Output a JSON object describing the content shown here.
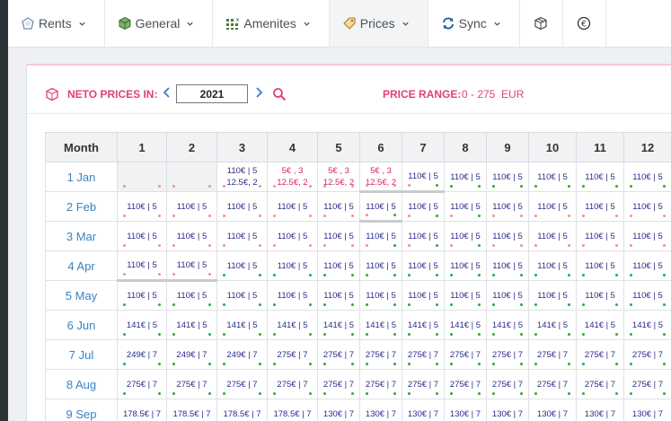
{
  "nav": [
    {
      "label": "Rents",
      "icon": "rents-icon",
      "dropdown": true
    },
    {
      "label": "General",
      "icon": "general-cube-icon",
      "dropdown": true
    },
    {
      "label": "Amenites",
      "icon": "amenities-grid-icon",
      "dropdown": true
    },
    {
      "label": "Prices",
      "icon": "price-tag-icon",
      "dropdown": true,
      "active": true
    },
    {
      "label": "Sync",
      "icon": "sync-icon",
      "dropdown": true
    },
    {
      "label": "",
      "icon": "box-icon",
      "dropdown": false
    },
    {
      "label": "",
      "icon": "euro-icon",
      "dropdown": false
    }
  ],
  "toolbar": {
    "neto_label": "NETO PRICES IN:",
    "year": "2021",
    "range_label": "PRICE RANGE:",
    "range_value": "0 - 275  EUR"
  },
  "grid": {
    "month_header": "Month",
    "days": [
      "1",
      "2",
      "3",
      "4",
      "5",
      "6",
      "7",
      "8",
      "9",
      "10",
      "11",
      "12"
    ],
    "rows": [
      {
        "month": "1 Jan",
        "cells": [
          {
            "t": "",
            "empty": true,
            "dot": "p",
            "dotl": "p"
          },
          {
            "t": "",
            "empty": true,
            "dot": "p",
            "dotl": "p"
          },
          {
            "t": "110€ | 5",
            "t2": "12.5€, 2",
            "dot": "p",
            "dotl": "p"
          },
          {
            "t": "5€ , 3",
            "t2": "12.5€, 2",
            "red": true,
            "dot": "p",
            "dotl": "p"
          },
          {
            "t": "5€ , 3",
            "t2": "12.5€, 2",
            "red": true,
            "dot": "p",
            "dotl": "p"
          },
          {
            "t": "5€ , 3",
            "t2": "12.5€, 2",
            "red": true,
            "dot": "p",
            "dotl": "p",
            "thick": true
          },
          {
            "t": "110€ | 5",
            "dot": "g",
            "dotl": "p",
            "thick": true
          },
          {
            "t": "110€ | 5",
            "dot": "g",
            "dotl": "g"
          },
          {
            "t": "110€ | 5",
            "dot": "g",
            "dotl": "g"
          },
          {
            "t": "110€ | 5",
            "dot": "g",
            "dotl": "g"
          },
          {
            "t": "110€ | 5",
            "dot": "g",
            "dotl": "g"
          },
          {
            "t": "110€ | 5",
            "dot": "g",
            "dotl": "g"
          }
        ]
      },
      {
        "month": "2 Feb",
        "cells": [
          {
            "t": "110€ | 5",
            "dot": "p",
            "dotl": "p"
          },
          {
            "t": "110€ | 5",
            "dot": "p",
            "dotl": "p"
          },
          {
            "t": "110€ | 5",
            "dot": "p",
            "dotl": "p"
          },
          {
            "t": "110€ | 5",
            "dot": "p",
            "dotl": "p"
          },
          {
            "t": "110€ | 5",
            "dot": "p",
            "dotl": "p"
          },
          {
            "t": "110€ | 5",
            "dot": "g",
            "dotl": "p",
            "thick": true
          },
          {
            "t": "110€ | 5",
            "dot": "g",
            "dotl": "p"
          },
          {
            "t": "110€ | 5",
            "dot": "g",
            "dotl": "p"
          },
          {
            "t": "110€ | 5",
            "dot": "p",
            "dotl": "p"
          },
          {
            "t": "110€ | 5",
            "dot": "p",
            "dotl": "p"
          },
          {
            "t": "110€ | 5",
            "dot": "p",
            "dotl": "p"
          },
          {
            "t": "110€ | 5",
            "dot": "p",
            "dotl": "p"
          }
        ]
      },
      {
        "month": "3 Mar",
        "cells": [
          {
            "t": "110€ | 5",
            "dot": "p",
            "dotl": "p"
          },
          {
            "t": "110€ | 5",
            "dot": "p",
            "dotl": "p"
          },
          {
            "t": "110€ | 5",
            "dot": "p",
            "dotl": "p"
          },
          {
            "t": "110€ | 5",
            "dot": "p",
            "dotl": "p"
          },
          {
            "t": "110€ | 5",
            "dot": "p",
            "dotl": "p"
          },
          {
            "t": "110€ | 5",
            "dot": "g",
            "dotl": "p"
          },
          {
            "t": "110€ | 5",
            "dot": "g",
            "dotl": "p"
          },
          {
            "t": "110€ | 5",
            "dot": "g",
            "dotl": "p"
          },
          {
            "t": "110€ | 5",
            "dot": "p",
            "dotl": "p"
          },
          {
            "t": "110€ | 5",
            "dot": "p",
            "dotl": "p"
          },
          {
            "t": "110€ | 5",
            "dot": "p",
            "dotl": "p"
          },
          {
            "t": "110€ | 5",
            "dot": "p",
            "dotl": "p"
          }
        ]
      },
      {
        "month": "4 Apr",
        "cells": [
          {
            "t": "110€ | 5",
            "dot": "p",
            "dotl": "p"
          },
          {
            "t": "110€ | 5",
            "dot": "p",
            "dotl": "p"
          },
          {
            "t": "110€ | 5",
            "dot": "g",
            "dotl": "g"
          },
          {
            "t": "110€ | 5",
            "dot": "g",
            "dotl": "g"
          },
          {
            "t": "110€ | 5",
            "dot": "g",
            "dotl": "g"
          },
          {
            "t": "110€ | 5",
            "dot": "g",
            "dotl": "g"
          },
          {
            "t": "110€ | 5",
            "dot": "g",
            "dotl": "g"
          },
          {
            "t": "110€ | 5",
            "dot": "g",
            "dotl": "g"
          },
          {
            "t": "110€ | 5",
            "dot": "g",
            "dotl": "g"
          },
          {
            "t": "110€ | 5",
            "dot": "g",
            "dotl": "g"
          },
          {
            "t": "110€ | 5",
            "dot": "g",
            "dotl": "g"
          },
          {
            "t": "110€ | 5",
            "dot": "g",
            "dotl": "g"
          }
        ]
      },
      {
        "month": "5 May",
        "cells": [
          {
            "t": "110€ | 5",
            "dot": "g",
            "dotl": "g",
            "thicktop": true
          },
          {
            "t": "110€ | 5",
            "dot": "g",
            "dotl": "g",
            "thicktop": true
          },
          {
            "t": "110€ | 5",
            "dot": "g",
            "dotl": "g"
          },
          {
            "t": "110€ | 5",
            "dot": "g",
            "dotl": "g"
          },
          {
            "t": "110€ | 5",
            "dot": "g",
            "dotl": "g"
          },
          {
            "t": "110€ | 5",
            "dot": "g",
            "dotl": "g"
          },
          {
            "t": "110€ | 5",
            "dot": "g",
            "dotl": "g"
          },
          {
            "t": "110€ | 5",
            "dot": "g",
            "dotl": "g"
          },
          {
            "t": "110€ | 5",
            "dot": "g",
            "dotl": "g"
          },
          {
            "t": "110€ | 5",
            "dot": "g",
            "dotl": "g"
          },
          {
            "t": "110€ | 5",
            "dot": "g",
            "dotl": "g"
          },
          {
            "t": "110€ | 5",
            "dot": "g",
            "dotl": "g"
          }
        ]
      },
      {
        "month": "6 Jun",
        "cells": [
          {
            "t": "141€ | 5",
            "dot": "g",
            "dotl": "g"
          },
          {
            "t": "141€ | 5",
            "dot": "g",
            "dotl": "g"
          },
          {
            "t": "141€ | 5",
            "dot": "g",
            "dotl": "g"
          },
          {
            "t": "141€ | 5",
            "dot": "g",
            "dotl": "g"
          },
          {
            "t": "141€ | 5",
            "dot": "g",
            "dotl": "g"
          },
          {
            "t": "141€ | 5",
            "dot": "g",
            "dotl": "g"
          },
          {
            "t": "141€ | 5",
            "dot": "g",
            "dotl": "g"
          },
          {
            "t": "141€ | 5",
            "dot": "g",
            "dotl": "g"
          },
          {
            "t": "141€ | 5",
            "dot": "g",
            "dotl": "g"
          },
          {
            "t": "141€ | 5",
            "dot": "g",
            "dotl": "g"
          },
          {
            "t": "141€ | 5",
            "dot": "g",
            "dotl": "g"
          },
          {
            "t": "141€ | 5",
            "dot": "g",
            "dotl": "g"
          }
        ]
      },
      {
        "month": "7 Jul",
        "cells": [
          {
            "t": "249€ | 7",
            "dot": "g",
            "dotl": "g"
          },
          {
            "t": "249€ | 7",
            "dot": "g",
            "dotl": "g"
          },
          {
            "t": "249€ | 7",
            "dot": "g",
            "dotl": "g"
          },
          {
            "t": "275€ | 7",
            "dot": "g",
            "dotl": "g"
          },
          {
            "t": "275€ | 7",
            "dot": "g",
            "dotl": "g"
          },
          {
            "t": "275€ | 7",
            "dot": "g",
            "dotl": "g"
          },
          {
            "t": "275€ | 7",
            "dot": "g",
            "dotl": "g"
          },
          {
            "t": "275€ | 7",
            "dot": "g",
            "dotl": "g"
          },
          {
            "t": "275€ | 7",
            "dot": "g",
            "dotl": "g"
          },
          {
            "t": "275€ | 7",
            "dot": "g",
            "dotl": "g"
          },
          {
            "t": "275€ | 7",
            "dot": "g",
            "dotl": "g"
          },
          {
            "t": "275€ | 7",
            "dot": "g",
            "dotl": "g"
          }
        ]
      },
      {
        "month": "8 Aug",
        "cells": [
          {
            "t": "275€ | 7",
            "dot": "g",
            "dotl": "g"
          },
          {
            "t": "275€ | 7",
            "dot": "g",
            "dotl": "g"
          },
          {
            "t": "275€ | 7",
            "dot": "g",
            "dotl": "g"
          },
          {
            "t": "275€ | 7",
            "dot": "g",
            "dotl": "g"
          },
          {
            "t": "275€ | 7",
            "dot": "g",
            "dotl": "g"
          },
          {
            "t": "275€ | 7",
            "dot": "g",
            "dotl": "g"
          },
          {
            "t": "275€ | 7",
            "dot": "g",
            "dotl": "g"
          },
          {
            "t": "275€ | 7",
            "dot": "g",
            "dotl": "g"
          },
          {
            "t": "275€ | 7",
            "dot": "g",
            "dotl": "g"
          },
          {
            "t": "275€ | 7",
            "dot": "g",
            "dotl": "g"
          },
          {
            "t": "275€ | 7",
            "dot": "g",
            "dotl": "g"
          },
          {
            "t": "275€ | 7",
            "dot": "g",
            "dotl": "g"
          }
        ]
      },
      {
        "month": "9 Sep",
        "cells": [
          {
            "t": "178.5€ | 7",
            "dot": "g",
            "dotl": "g"
          },
          {
            "t": "178.5€ | 7",
            "dot": "g",
            "dotl": "g"
          },
          {
            "t": "178.5€ | 7",
            "dot": "g",
            "dotl": "g"
          },
          {
            "t": "178.5€ | 7",
            "dot": "g",
            "dotl": "g"
          },
          {
            "t": "130€ | 7",
            "dot": "g",
            "dotl": "g"
          },
          {
            "t": "130€ | 7",
            "dot": "g",
            "dotl": "g"
          },
          {
            "t": "130€ | 7",
            "dot": "g",
            "dotl": "g"
          },
          {
            "t": "130€ | 7",
            "dot": "g",
            "dotl": "g"
          },
          {
            "t": "130€ | 7",
            "dot": "g",
            "dotl": "g"
          },
          {
            "t": "130€ | 7",
            "dot": "g",
            "dotl": "g"
          },
          {
            "t": "130€ | 7",
            "dot": "g",
            "dotl": "g"
          },
          {
            "t": "130€ | 7",
            "dot": "g",
            "dotl": "g"
          }
        ]
      }
    ]
  },
  "colors": {
    "accent_pink": "#e0407a",
    "link_blue": "#3b82c4",
    "price_text": "#2c2c8c",
    "dot_green": "#2faa3a",
    "dot_pink": "#f08f9c"
  }
}
